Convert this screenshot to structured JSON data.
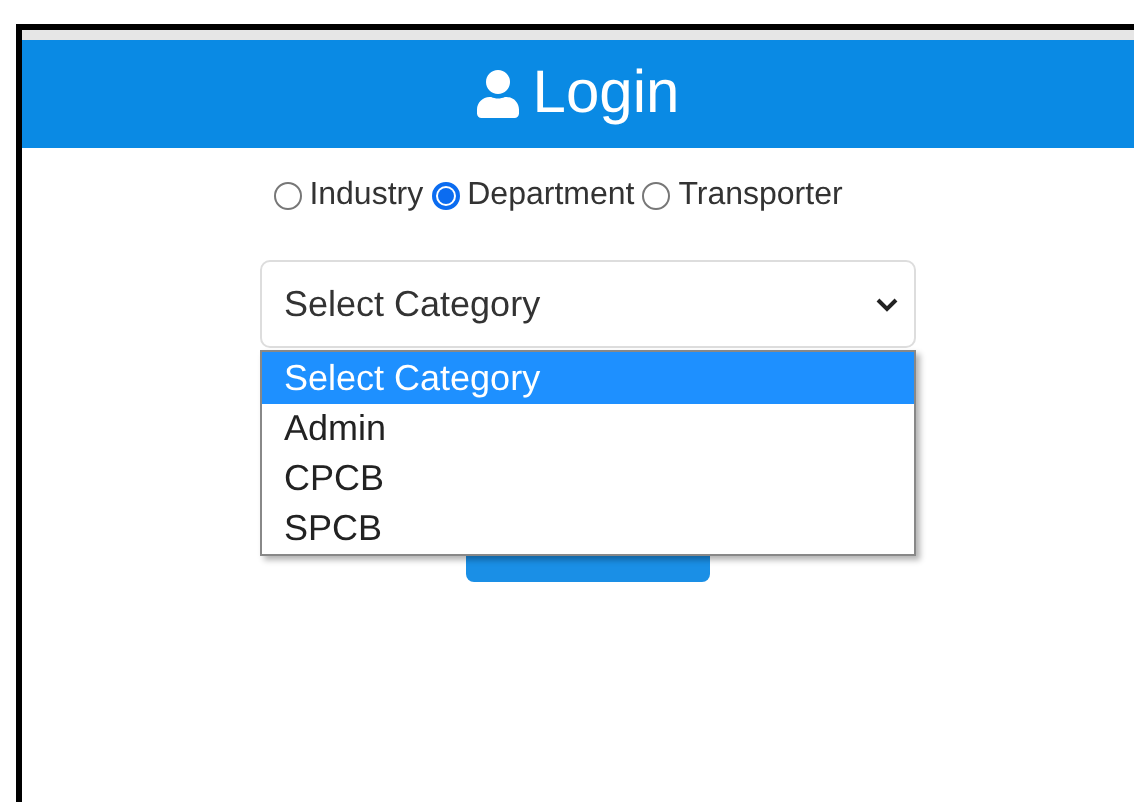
{
  "header": {
    "title": "Login"
  },
  "user_types": [
    {
      "label": "Industry",
      "selected": false
    },
    {
      "label": "Department",
      "selected": true
    },
    {
      "label": "Transporter",
      "selected": false
    }
  ],
  "category_select": {
    "value": "Select Category",
    "expanded": true,
    "options": [
      {
        "label": "Select Category",
        "selected": true
      },
      {
        "label": "Admin",
        "selected": false
      },
      {
        "label": "CPCB",
        "selected": false
      },
      {
        "label": "SPCB",
        "selected": false
      }
    ]
  }
}
